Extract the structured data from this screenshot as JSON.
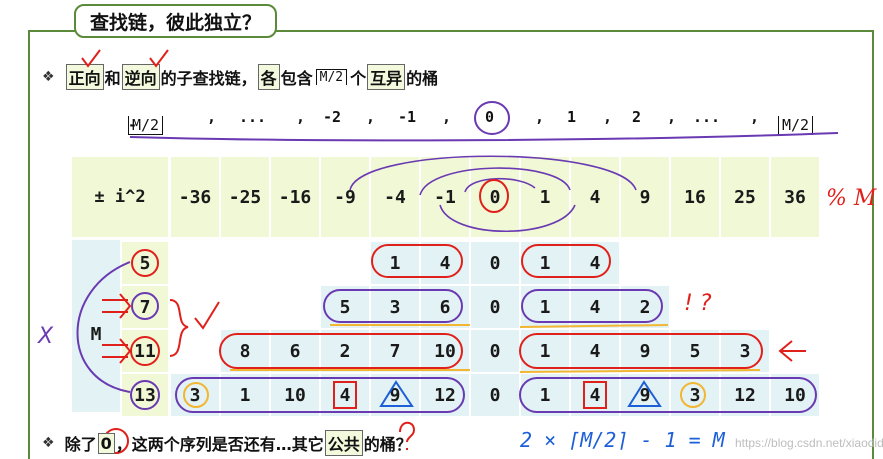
{
  "title": "查找链，彼此独立？",
  "bullet1": {
    "mark": "❖",
    "w1": "正向",
    "t1": "和",
    "w2": "逆向",
    "t2": "的子查找链，",
    "w3": "各",
    "t3": "包含",
    "ceil": "M/2",
    "t4": "个",
    "w4": "互异",
    "t5": "的桶"
  },
  "sequence": {
    "neg_prefix": "-",
    "neg_floor": "M/2",
    "items": [
      ",",
      "...",
      ",",
      "-2",
      ",",
      "-1",
      ",",
      "0",
      ",",
      "1",
      ",",
      "2",
      ",",
      "...",
      ","
    ],
    "pos_floor": "M/2"
  },
  "table": {
    "header_label": "± i^2",
    "header_values": [
      "-36",
      "-25",
      "-16",
      "-9",
      "-4",
      "-1",
      "0",
      "1",
      "4",
      "9",
      "16",
      "25",
      "36"
    ],
    "rows": [
      {
        "m": "5",
        "values": [
          "",
          "",
          "",
          "",
          "1",
          "4",
          "0",
          "1",
          "4",
          "",
          "",
          "",
          ""
        ]
      },
      {
        "m": "7",
        "values": [
          "",
          "",
          "",
          "5",
          "3",
          "6",
          "0",
          "1",
          "4",
          "2",
          "",
          "",
          ""
        ]
      },
      {
        "m": "11",
        "values": [
          "",
          "8",
          "6",
          "2",
          "7",
          "10",
          "0",
          "1",
          "4",
          "9",
          "5",
          "3",
          ""
        ]
      },
      {
        "m": "13",
        "values": [
          "3",
          "1",
          "10",
          "4",
          "9",
          "12",
          "0",
          "1",
          "4",
          "9",
          "3",
          "12",
          "10"
        ]
      }
    ],
    "side_label": "M"
  },
  "annotations": {
    "percent_m": "% M",
    "exclaim": "! ?",
    "cross": "X"
  },
  "bullet2": {
    "mark": "❖",
    "t1": "除了",
    "w1": "0",
    "t2": "，这两个序列是否还有…其它",
    "w2": "公共",
    "t3": "的桶？"
  },
  "formula": "2 × ⌈M/2⌉ - 1 = M",
  "watermark": "https://blog.csdn.net/xiaodidadada"
}
